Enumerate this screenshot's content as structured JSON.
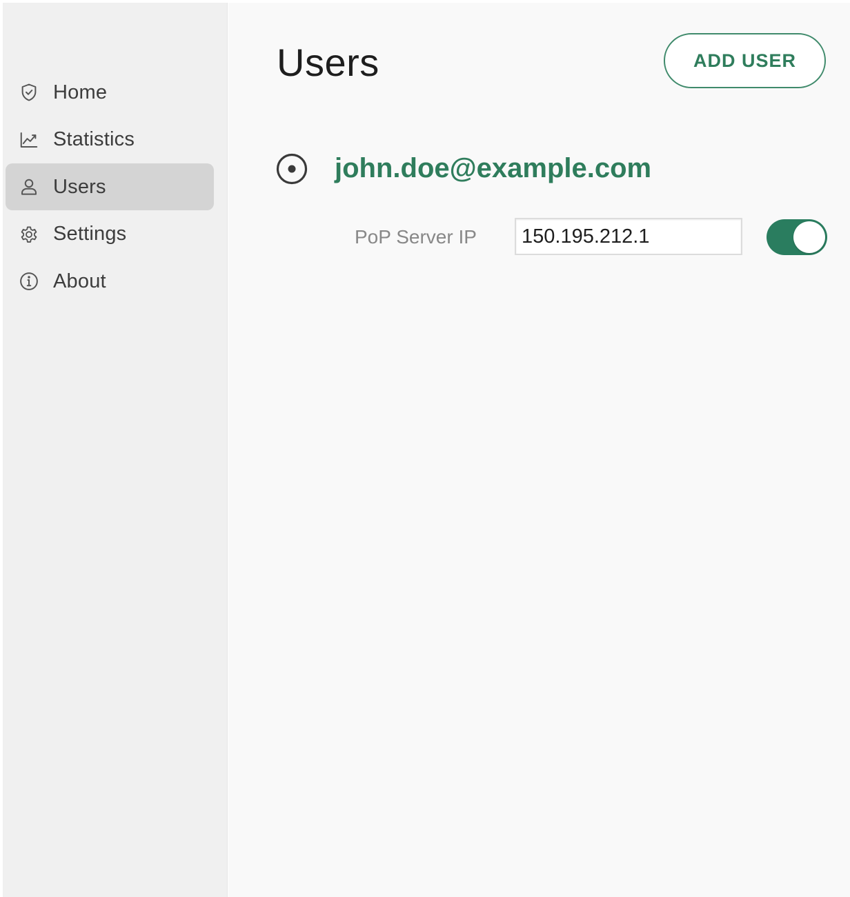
{
  "sidebar": {
    "items": [
      {
        "label": "Home",
        "icon": "shield-check-icon",
        "active": false
      },
      {
        "label": "Statistics",
        "icon": "chart-line-icon",
        "active": false
      },
      {
        "label": "Users",
        "icon": "user-icon",
        "active": true
      },
      {
        "label": "Settings",
        "icon": "gear-icon",
        "active": false
      },
      {
        "label": "About",
        "icon": "info-icon",
        "active": false
      }
    ]
  },
  "main": {
    "title": "Users",
    "add_user_label": "ADD USER",
    "user": {
      "email": "john.doe@example.com",
      "selected": true,
      "pop_label": "PoP Server IP",
      "pop_value": "150.195.212.1",
      "enabled": true
    }
  },
  "colors": {
    "accent": "#2f7d5c",
    "toggle_on": "#2a7d5f",
    "sidebar_bg": "#f0f0f0",
    "sidebar_active": "#d4d4d4",
    "main_bg": "#f9f9f9"
  }
}
